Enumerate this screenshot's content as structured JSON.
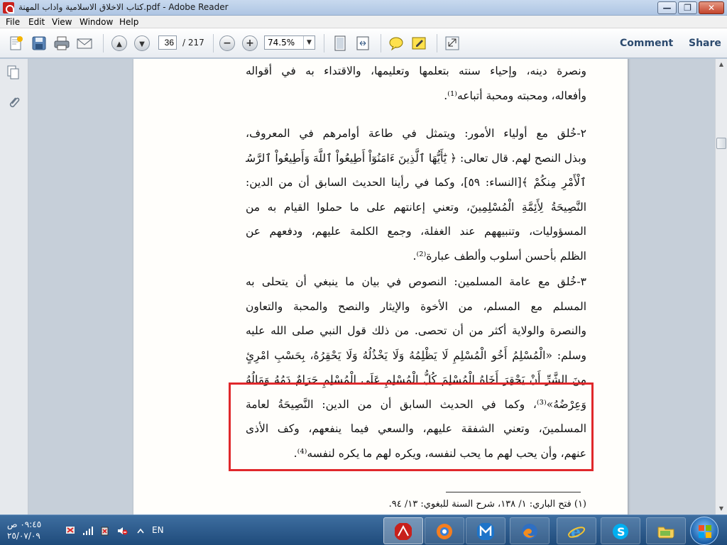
{
  "window": {
    "title": "كتاب الاخلاق الاسلامية واداب المهنة.pdf - Adobe Reader",
    "min_glyph": "—",
    "max_glyph": "❐",
    "close_glyph": "✕"
  },
  "menu": {
    "items": [
      "File",
      "Edit",
      "View",
      "Window",
      "Help"
    ]
  },
  "toolbar": {
    "page_current": "36",
    "page_total": "/ 217",
    "zoom": "74.5%",
    "zoom_out_glyph": "−",
    "zoom_in_glyph": "+",
    "prev_glyph": "▲",
    "next_glyph": "▼",
    "dropdown_glyph": "▼",
    "comment_label": "Comment",
    "share_label": "Share"
  },
  "document": {
    "paragraphs": [
      {
        "lines": [
          "ونصرة دينه، وإحياء سنته بتعلمها وتعليمها، والاقتداء به في أقواله",
          "وأفعاله، ومحبته ومحبة أتباعه⁽¹⁾."
        ]
      },
      {
        "lines": [
          "٢-خُلق مع أولياء الأمور: ويتمثل في طاعة أوامرهم في المعروف،",
          "وبذل النصح لهم. قال تعالى: ﴿ يَٰٓأَيُّهَا ٱلَّذِينَ ءَامَنُوٓاْ أَطِيعُواْ ٱللَّهَ وَأَطِيعُواْ ٱلرَّسُولَ وَأُوْلِي",
          "ٱلْأَمْرِ مِنكُمْ ﴾[النساء: ٥٩]، وكما في رأينا الحديث السابق أن من الدين:",
          "النَّصِيحَةُ لِأَئِمَّةِ الْمُسْلِمِينَ، وتعني إعانتهم على ما حملوا القيام به من",
          "المسؤوليات، وتنبيههم عند الغفلة، وجمع الكلمة عليهم، ودفعهم عن",
          "الظلم بأحسن أسلوب وألطف عبارة⁽²⁾."
        ]
      },
      {
        "lines": [
          "٣-خُلق مع عامة المسلمين: النصوص في بيان ما ينبغي أن يتحلى به",
          "المسلم مع المسلم، من الأخوة والإيثار والنصح والمحبة والتعاون",
          "والنصرة والولاية أكثر من أن تحصى. من ذلك قول النبي صلى الله عليه",
          "وسلم: «الْمُسْلِمُ أَخُو الْمُسْلِمِ لَا يَظْلِمُهُ وَلَا يَخْذُلُهُ وَلَا يَحْقِرُهُ، بِحَسْبِ امْرِئٍ",
          "مِنَ الشَّرِّ أَنْ يَحْقِرَ أَخَاهُ الْمُسْلِمَ كُلُّ الْمُسْلِمِ عَلَى الْمُسْلِمِ حَرَامٌ دَمُهُ وَمَالُهُ",
          "وَعِرْضُهُ»⁽³⁾، وكما في الحديث السابق أن من الدين: النَّصِيحَةُ لعامة",
          "المسلمينَ، وتعني الشفقة عليهم، والسعي فيما ينفعهم، وكف الأذى",
          "عنهم، وأن يحب لهم ما يحب لنفسه، ويكره لهم ما يكره لنفسه⁽⁴⁾."
        ]
      }
    ],
    "footnote": "(١) فتح الباري: ١/ ١٣٨، شرح السنة للبغوي: ١٣/ ٩٤."
  },
  "taskbar": {
    "time": "٠٩:٤٥ ص",
    "date": "٢٥/٠٧/٠٩",
    "language": "EN"
  },
  "colors": {
    "highlight_border": "#e0282b",
    "acrobat_red": "#c8201c"
  }
}
